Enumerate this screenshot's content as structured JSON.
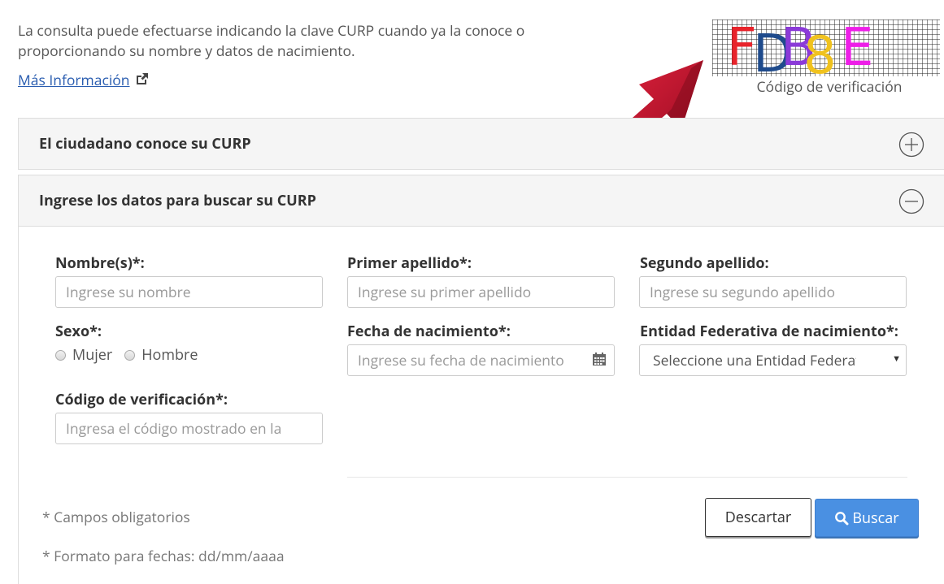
{
  "intro": {
    "text": "La consulta puede efectuarse indicando la clave CURP cuando ya la conoce o proporcionando su nombre y datos de nacimiento.",
    "more_link": "Más Información",
    "more_icon": "external-link-icon"
  },
  "captcha": {
    "characters": [
      "F",
      "D",
      "B",
      "8",
      "E"
    ],
    "colors": [
      "#e8232b",
      "#1f4b8c",
      "#8b3ad8",
      "#f0c21e",
      "#ee1ee8"
    ],
    "caption": "Código de verificación"
  },
  "panels": {
    "curp_known": {
      "title": "El ciudadano conoce su CURP",
      "state": "collapsed",
      "icon": "plus-circle-icon"
    },
    "search_by_data": {
      "title": "Ingrese los datos para buscar su CURP",
      "state": "expanded",
      "icon": "minus-circle-icon"
    }
  },
  "form": {
    "nombre": {
      "label": "Nombre(s)*:",
      "placeholder": "Ingrese su nombre",
      "value": ""
    },
    "primer_apellido": {
      "label": "Primer apellido*:",
      "placeholder": "Ingrese su primer apellido",
      "value": ""
    },
    "segundo_apellido": {
      "label": "Segundo apellido:",
      "placeholder": "Ingrese su segundo apellido",
      "value": ""
    },
    "sexo": {
      "label": "Sexo*:",
      "options": [
        "Mujer",
        "Hombre"
      ],
      "selected": null
    },
    "fecha": {
      "label": "Fecha de nacimiento*:",
      "placeholder": "Ingrese su fecha de nacimiento",
      "icon": "calendar-icon"
    },
    "entidad": {
      "label": "Entidad Federativa de nacimiento*:",
      "selected": "Seleccione una Entidad Federativa"
    },
    "codigo": {
      "label": "Código de verificación*:",
      "placeholder": "Ingresa el código mostrado en la"
    }
  },
  "notes": {
    "required": "* Campos obligatorios",
    "date_format": "* Formato para fechas: dd/mm/aaaa"
  },
  "buttons": {
    "discard": "Descartar",
    "search": "Buscar",
    "search_icon": "search-icon"
  },
  "colors": {
    "link": "#2a5db0",
    "primary_button": "#4a90e2",
    "arrow": "#c8102e"
  }
}
